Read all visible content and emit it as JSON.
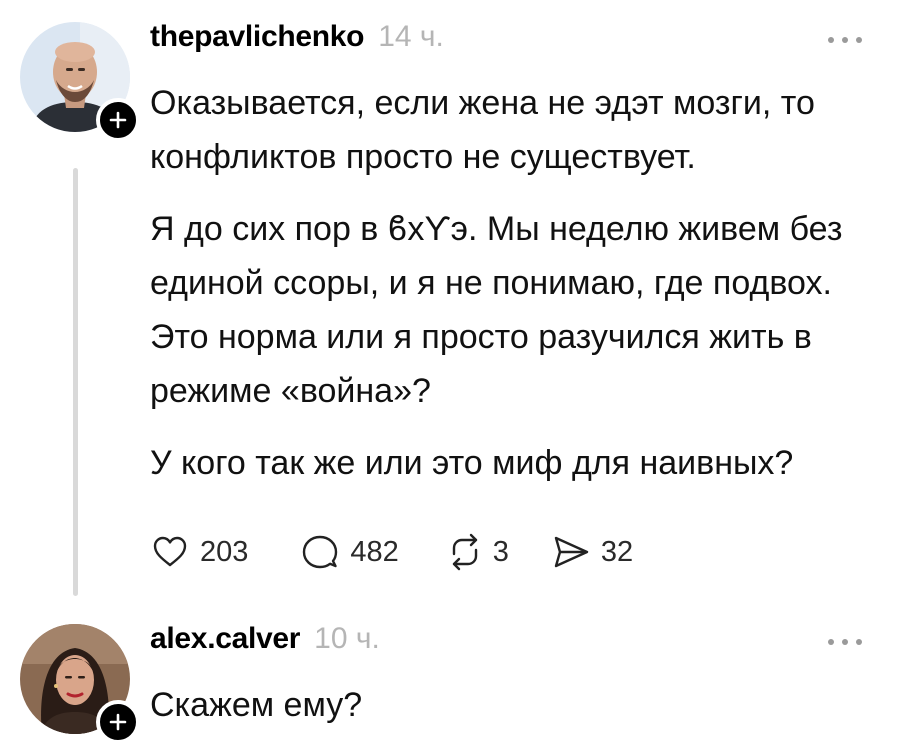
{
  "posts": [
    {
      "username": "thepavlichenko",
      "timestamp": "14 ч.",
      "paragraphs": [
        "Оказывается, если жена не эдэт мозги, то конфликтов просто не существует.",
        "Я до сих пор в ϐхϒэ. Мы неделю живем без единой ссоры, и я не понимаю, где подвох. Это норма или я просто разучился жить в режиме «война»?",
        "У кого так же или это миф для наивных?"
      ],
      "likes": "203",
      "replies": "482",
      "reposts": "3",
      "shares": "32"
    },
    {
      "username": "alex.calver",
      "timestamp": "10 ч.",
      "paragraphs": [
        "Скажем ему?"
      ]
    }
  ],
  "icons": {
    "like": "heart-icon",
    "reply": "speech-bubble-icon",
    "repost": "repost-arrows-icon",
    "share": "send-arrow-icon",
    "more": "ellipsis-icon",
    "follow": "plus-icon"
  },
  "colors": {
    "text": "#000000",
    "muted": "#b5b5b5",
    "thread_line": "#d9d9d9",
    "badge": "#000000"
  }
}
